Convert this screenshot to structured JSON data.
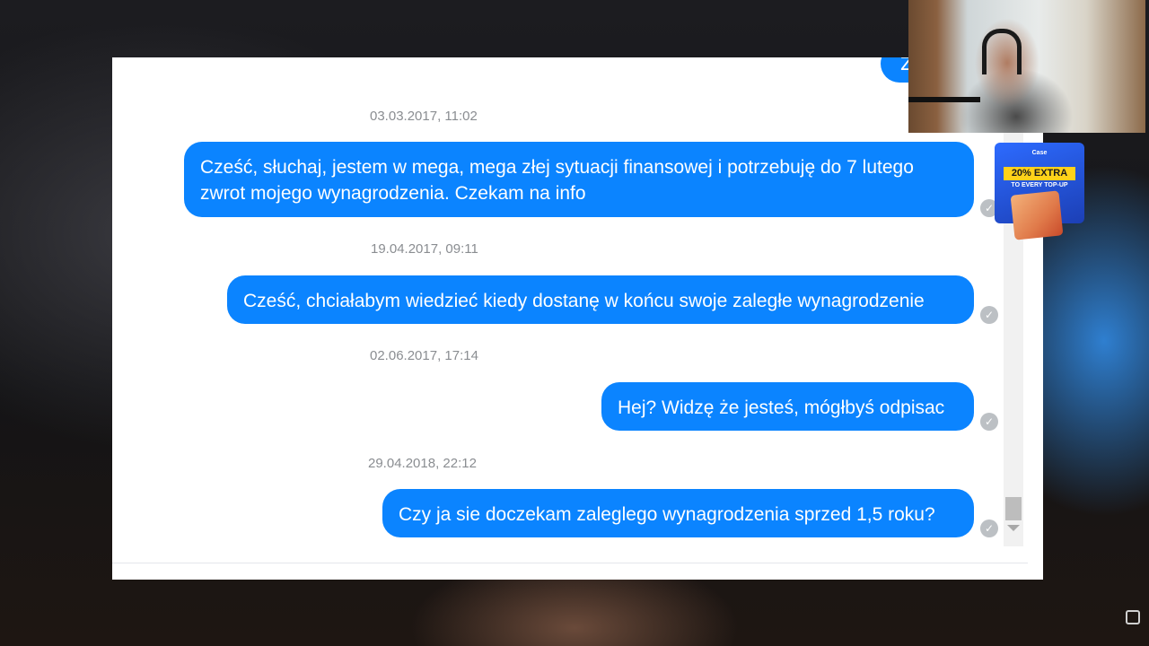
{
  "conversation": {
    "previous_bubble_fragment": "Z",
    "messages": [
      {
        "timestamp": "03.03.2017, 11:02",
        "text": "Cześć, słuchaj, jestem w mega, mega złej sytuacji finansowej i potrzebuję do 7 lutego zwrot mojego wynagrodzenia. Czekam na info"
      },
      {
        "timestamp": "19.04.2017, 09:11",
        "text": "Cześć, chciałabym wiedzieć kiedy dostanę w końcu swoje zaległe wynagrodzenie"
      },
      {
        "timestamp": "02.06.2017, 17:14",
        "text": "Hej? Widzę że jesteś, mógłbyś odpisac"
      },
      {
        "timestamp": "29.04.2018, 22:12",
        "text": "Czy ja sie doczekam zaleglego wynagrodzenia sprzed 1,5 roku?"
      }
    ],
    "read_receipt_icon": "check-circle-icon"
  },
  "ad": {
    "brand": "Case",
    "headline": "20% EXTRA",
    "subline": "TO EVERY TOP-UP"
  },
  "colors": {
    "bubble": "#0b84ff",
    "timestamp": "#8a8d91",
    "read_receipt": "#bcc0c4"
  }
}
